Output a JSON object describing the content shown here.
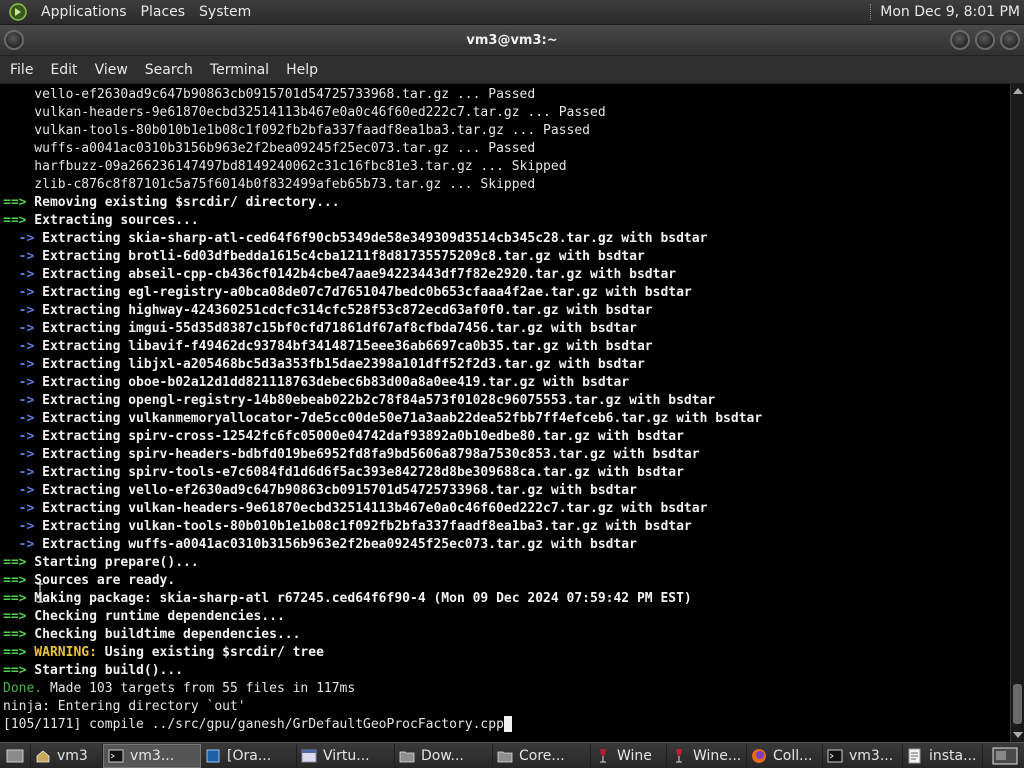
{
  "top_panel": {
    "applications": "Applications",
    "places": "Places",
    "system": "System",
    "clock": "Mon Dec  9,  8:01 PM"
  },
  "window": {
    "title": "vm3@vm3:~"
  },
  "menubar": {
    "items": [
      "File",
      "Edit",
      "View",
      "Search",
      "Terminal",
      "Help"
    ]
  },
  "terminal": {
    "lines": [
      {
        "type": "check",
        "text": "    vello-ef2630ad9c647b90863cb0915701d54725733968.tar.gz ... Passed"
      },
      {
        "type": "check",
        "text": "    vulkan-headers-9e61870ecbd32514113b467e0a0c46f60ed222c7.tar.gz ... Passed"
      },
      {
        "type": "check",
        "text": "    vulkan-tools-80b010b1e1b08c1f092fb2bfa337faadf8ea1ba3.tar.gz ... Passed"
      },
      {
        "type": "check",
        "text": "    wuffs-a0041ac0310b3156b963e2f2bea09245f25ec073.tar.gz ... Passed"
      },
      {
        "type": "check",
        "text": "    harfbuzz-09a266236147497bd8149240062c31c16fbc81e3.tar.gz ... Skipped"
      },
      {
        "type": "check",
        "text": "    zlib-c876c8f87101c5a75f6014b0f832499afeb65b73.tar.gz ... Skipped"
      },
      {
        "type": "step",
        "prefix": "==>",
        "text": " Removing existing $srcdir/ directory..."
      },
      {
        "type": "step",
        "prefix": "==>",
        "text": " Extracting sources..."
      },
      {
        "type": "sub",
        "prefix": "  ->",
        "text": " Extracting skia-sharp-atl-ced64f6f90cb5349de58e349309d3514cb345c28.tar.gz with bsdtar"
      },
      {
        "type": "sub",
        "prefix": "  ->",
        "text": " Extracting brotli-6d03dfbedda1615c4cba1211f8d81735575209c8.tar.gz with bsdtar"
      },
      {
        "type": "sub",
        "prefix": "  ->",
        "text": " Extracting abseil-cpp-cb436cf0142b4cbe47aae94223443df7f82e2920.tar.gz with bsdtar"
      },
      {
        "type": "sub",
        "prefix": "  ->",
        "text": " Extracting egl-registry-a0bca08de07c7d7651047bedc0b653cfaaa4f2ae.tar.gz with bsdtar"
      },
      {
        "type": "sub",
        "prefix": "  ->",
        "text": " Extracting highway-424360251cdcfc314cfc528f53c872ecd63af0f0.tar.gz with bsdtar"
      },
      {
        "type": "sub",
        "prefix": "  ->",
        "text": " Extracting imgui-55d35d8387c15bf0cfd71861df67af8cfbda7456.tar.gz with bsdtar"
      },
      {
        "type": "sub",
        "prefix": "  ->",
        "text": " Extracting libavif-f49462dc93784bf34148715eee36ab6697ca0b35.tar.gz with bsdtar"
      },
      {
        "type": "sub",
        "prefix": "  ->",
        "text": " Extracting libjxl-a205468bc5d3a353fb15dae2398a101dff52f2d3.tar.gz with bsdtar"
      },
      {
        "type": "sub",
        "prefix": "  ->",
        "text": " Extracting oboe-b02a12d1dd821118763debec6b83d00a8a0ee419.tar.gz with bsdtar"
      },
      {
        "type": "sub",
        "prefix": "  ->",
        "text": " Extracting opengl-registry-14b80ebeab022b2c78f84a573f01028c96075553.tar.gz with bsdtar"
      },
      {
        "type": "sub",
        "prefix": "  ->",
        "text": " Extracting vulkanmemoryallocator-7de5cc00de50e71a3aab22dea52fbb7ff4efceb6.tar.gz with bsdtar"
      },
      {
        "type": "sub",
        "prefix": "  ->",
        "text": " Extracting spirv-cross-12542fc6fc05000e04742daf93892a0b10edbe80.tar.gz with bsdtar"
      },
      {
        "type": "sub",
        "prefix": "  ->",
        "text": " Extracting spirv-headers-bdbfd019be6952fd8fa9bd5606a8798a7530c853.tar.gz with bsdtar"
      },
      {
        "type": "sub",
        "prefix": "  ->",
        "text": " Extracting spirv-tools-e7c6084fd1d6d6f5ac393e842728d8be309688ca.tar.gz with bsdtar"
      },
      {
        "type": "sub",
        "prefix": "  ->",
        "text": " Extracting vello-ef2630ad9c647b90863cb0915701d54725733968.tar.gz with bsdtar"
      },
      {
        "type": "sub",
        "prefix": "  ->",
        "text": " Extracting vulkan-headers-9e61870ecbd32514113b467e0a0c46f60ed222c7.tar.gz with bsdtar"
      },
      {
        "type": "sub",
        "prefix": "  ->",
        "text": " Extracting vulkan-tools-80b010b1e1b08c1f092fb2bfa337faadf8ea1ba3.tar.gz with bsdtar"
      },
      {
        "type": "sub",
        "prefix": "  ->",
        "text": " Extracting wuffs-a0041ac0310b3156b963e2f2bea09245f25ec073.tar.gz with bsdtar"
      },
      {
        "type": "step",
        "prefix": "==>",
        "text": " Starting prepare()..."
      },
      {
        "type": "step",
        "prefix": "==>",
        "text": " Sources are ready."
      },
      {
        "type": "step",
        "prefix": "==>",
        "text": " Making package: skia-sharp-atl r67245.ced64f6f90-4 (Mon 09 Dec 2024 07:59:42 PM EST)"
      },
      {
        "type": "step",
        "prefix": "==>",
        "text": " Checking runtime dependencies..."
      },
      {
        "type": "step",
        "prefix": "==>",
        "text": " Checking buildtime dependencies..."
      },
      {
        "type": "warn",
        "prefix": "==>",
        "label": " WARNING:",
        "text": " Using existing $srcdir/ tree"
      },
      {
        "type": "step",
        "prefix": "==>",
        "text": " Starting build()..."
      },
      {
        "type": "done",
        "label": "Done.",
        "text": " Made 103 targets from 55 files in 117ms"
      },
      {
        "type": "plain",
        "text": "ninja: Entering directory `out'"
      },
      {
        "type": "prompt",
        "text": "[105/1171] compile ../src/gpu/ganesh/GrDefaultGeoProcFactory.cpp"
      }
    ]
  },
  "taskbar": {
    "items": [
      {
        "label": "vm3",
        "icon": "home-folder-icon"
      },
      {
        "label": "vm3...",
        "icon": "terminal-icon",
        "active": true
      },
      {
        "label": "[Ora...",
        "icon": "virtualbox-icon"
      },
      {
        "label": "Virtu...",
        "icon": "window-icon"
      },
      {
        "label": "Dow...",
        "icon": "folder-icon"
      },
      {
        "label": "Core...",
        "icon": "folder-icon"
      },
      {
        "label": "Wine",
        "icon": "wine-icon"
      },
      {
        "label": "Wine...",
        "icon": "wine-icon"
      },
      {
        "label": "Coll...",
        "icon": "firefox-icon"
      },
      {
        "label": "vm3...",
        "icon": "terminal-icon"
      },
      {
        "label": "insta...",
        "icon": "text-editor-icon"
      }
    ]
  },
  "colors": {
    "green_arrow": "#4fd24f",
    "blue_arrow": "#5b7fe0",
    "warning": "#e8c53a",
    "done": "#4fb04f"
  }
}
